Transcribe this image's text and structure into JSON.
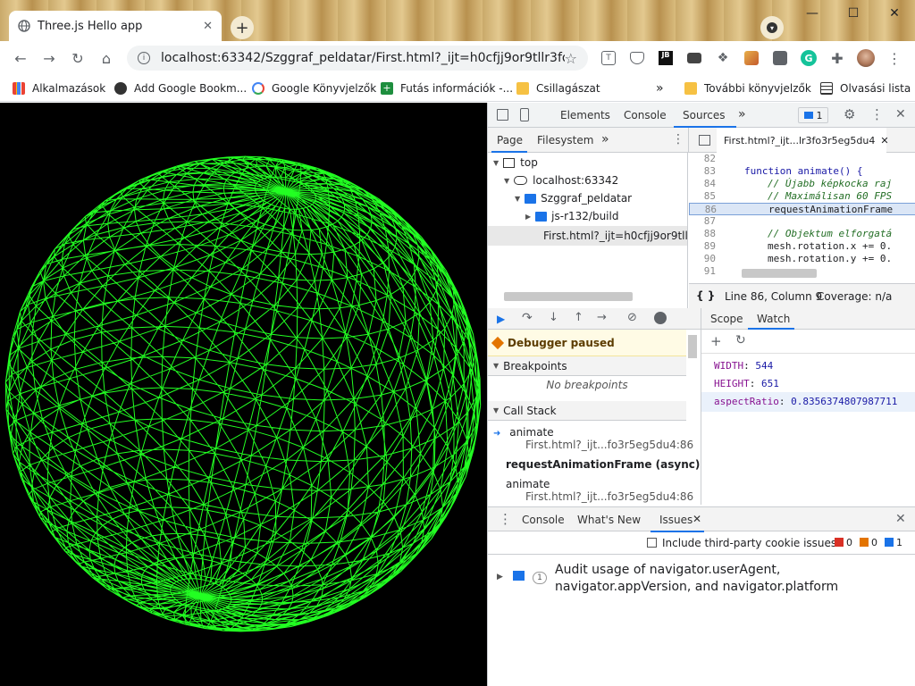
{
  "browser": {
    "tab_title": "Three.js Hello app",
    "new_tab_label": "+",
    "url": "localhost:63342/Szggraf_peldatar/First.html?_ijt=h0cfjj9or9tllr3fo3r5eg...",
    "window_controls": {
      "minimize": "—",
      "maximize": "☐",
      "close": "✕"
    }
  },
  "bookmarks": [
    {
      "label": "Alkalmazások",
      "icon": "apps-grid-icon"
    },
    {
      "label": "Add Google Bookm...",
      "icon": "globe-icon"
    },
    {
      "label": "Google Könyvjelzők",
      "icon": "google-g-icon"
    },
    {
      "label": "Futás információk -...",
      "icon": "green-plus-icon"
    },
    {
      "label": "Csillagászat",
      "icon": "folder-icon"
    },
    {
      "label": "További könyvjelzők",
      "icon": "folder-icon"
    },
    {
      "label": "Olvasási lista",
      "icon": "reading-list-icon"
    }
  ],
  "bookmarks_more": "»",
  "devtools": {
    "tabs": [
      "Elements",
      "Console",
      "Sources"
    ],
    "active_tab": "Sources",
    "issues_badge": "1",
    "navigator_tabs": [
      "Page",
      "Filesystem"
    ],
    "file_tree": [
      {
        "label": "top",
        "level": 0
      },
      {
        "label": "localhost:63342",
        "level": 1
      },
      {
        "label": "Szggraf_peldatar",
        "level": 2
      },
      {
        "label": "js-r132/build",
        "level": 3
      },
      {
        "label": "First.html?_ijt=h0cfjj9or9tllr3",
        "level": 3
      }
    ],
    "editor_tab": "First.html?_ijt...lr3fo3r5eg5du4",
    "code_lines": [
      {
        "n": "82",
        "text": ""
      },
      {
        "n": "83",
        "text": "function animate() {"
      },
      {
        "n": "84",
        "text": "// Újabb képkocka raj"
      },
      {
        "n": "85",
        "text": "// Maximálisan 60 FPS"
      },
      {
        "n": "86",
        "text": "requestAnimationFrame"
      },
      {
        "n": "87",
        "text": ""
      },
      {
        "n": "88",
        "text": "// Objektum elforgatá"
      },
      {
        "n": "89",
        "text": "mesh.rotation.x += 0."
      },
      {
        "n": "90",
        "text": "mesh.rotation.y += 0."
      },
      {
        "n": "91",
        "text": ""
      }
    ],
    "status_bar": "Line 86, Column 9",
    "coverage": "Coverage: n/a",
    "debugger_paused": "Debugger paused",
    "breakpoints_header": "Breakpoints",
    "no_breakpoints": "No breakpoints",
    "call_stack_header": "Call Stack",
    "call_stack": [
      {
        "fn": "animate",
        "loc": "First.html?_ijt...fo3r5eg5du4:86"
      },
      {
        "fn": "requestAnimationFrame (async)",
        "loc": ""
      },
      {
        "fn": "animate",
        "loc": "First.html?_ijt...fo3r5eg5du4:86"
      }
    ],
    "scope_tab": "Scope",
    "watch_tab": "Watch",
    "watch": [
      {
        "key": "WIDTH",
        "value": "544"
      },
      {
        "key": "HEIGHT",
        "value": "651"
      },
      {
        "key": "aspectRatio",
        "value": "0.8356374807987711"
      }
    ],
    "drawer_tabs": [
      "Console",
      "What's New",
      "Issues"
    ],
    "include_third_party": "Include third-party cookie issues",
    "issue_counts": {
      "errors": "0",
      "warnings": "0",
      "info": "1"
    },
    "issue_count_badge": "1",
    "issue_text": "Audit usage of navigator.userAgent, navigator.appVersion, and navigator.platform"
  }
}
